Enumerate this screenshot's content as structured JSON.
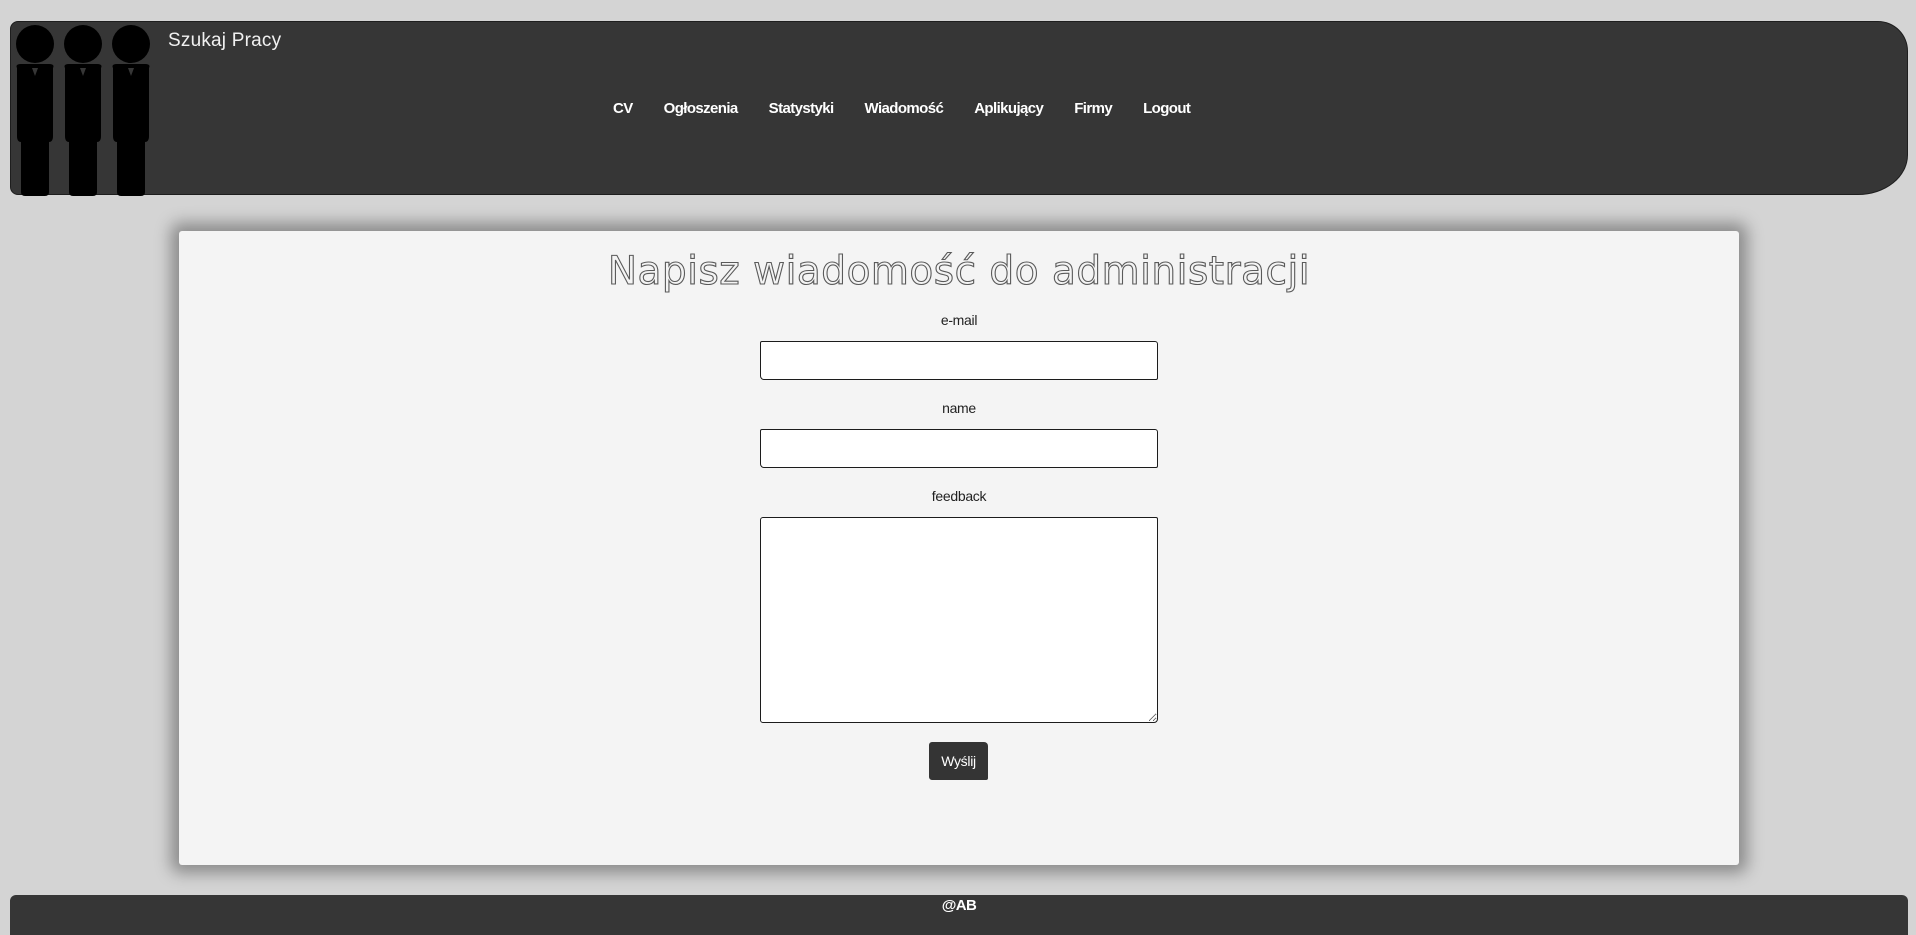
{
  "header": {
    "brand": "Szukaj Pracy",
    "logo_icon": "people-group-icon",
    "nav": [
      {
        "label": "CV"
      },
      {
        "label": "Ogłoszenia"
      },
      {
        "label": "Statystyki"
      },
      {
        "label": "Wiadomość"
      },
      {
        "label": "Aplikujący"
      },
      {
        "label": "Firmy"
      },
      {
        "label": "Logout"
      }
    ]
  },
  "form": {
    "title": "Napisz wiadomość do administracji",
    "email_label": "e-mail",
    "email_value": "",
    "name_label": "name",
    "name_value": "",
    "feedback_label": "feedback",
    "feedback_value": "",
    "submit_label": "Wyślij"
  },
  "footer": {
    "text": "@AB"
  },
  "colors": {
    "page_background": "#d4d4d4",
    "bar_background": "#363636",
    "card_background": "#f4f4f4",
    "button_background": "#343434"
  }
}
